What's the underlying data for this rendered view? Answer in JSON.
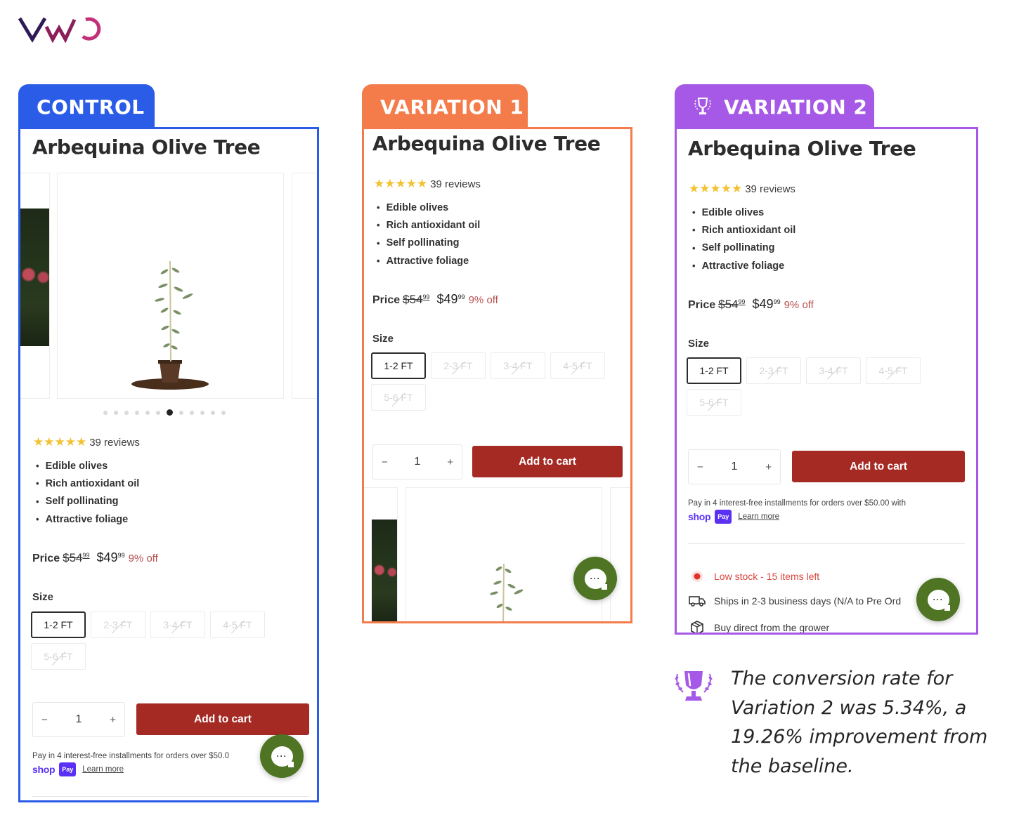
{
  "brand": {
    "logo_text": "VWO",
    "colors": {
      "v": "#2e1a55",
      "w": "#8a1f5a",
      "o": "#c2307a"
    }
  },
  "colors": {
    "control": "#2a5ce8",
    "variation1": "#f47c4a",
    "variation2": "#a659e6",
    "cart_button": "#a62a24",
    "chat_button": "#4e7424",
    "star": "#f2c232",
    "discount": "#b85050",
    "low_stock": "#d9453d"
  },
  "panels": [
    {
      "id": "control",
      "tab_label": "CONTROL",
      "has_trophy": false,
      "product_title": "Arbequina Olive Tree",
      "rating": {
        "stars": 5,
        "max": 5,
        "reviews_label": "39 reviews"
      },
      "bullets": [
        "Edible olives",
        "Rich antioxidant oil",
        "Self pollinating",
        "Attractive foliage"
      ],
      "price": {
        "label": "Price",
        "old_whole": "$54",
        "old_cents": "99",
        "new_whole": "$49",
        "new_cents": "99",
        "discount": "9% off"
      },
      "size": {
        "label": "Size",
        "options": [
          {
            "label": "1-2 FT",
            "state": "selected"
          },
          {
            "label": "2-3 FT",
            "state": "disabled"
          },
          {
            "label": "3-4 FT",
            "state": "disabled"
          },
          {
            "label": "4-5 FT",
            "state": "disabled"
          },
          {
            "label": "5-6 FT",
            "state": "disabled"
          }
        ]
      },
      "quantity": {
        "minus": "−",
        "value": "1",
        "plus": "+"
      },
      "add_to_cart": "Add to cart",
      "gallery": {
        "dot_count": 12,
        "active_index": 6
      },
      "installments": {
        "text": "Pay in 4 interest-free installments for orders over $50.0",
        "shop": "shop",
        "pay": "Pay",
        "learn_more": "Learn more"
      }
    },
    {
      "id": "variation1",
      "tab_label": "VARIATION 1",
      "has_trophy": false,
      "product_title": "Arbequina Olive Tree",
      "rating": {
        "stars": 5,
        "max": 5,
        "reviews_label": "39 reviews"
      },
      "bullets": [
        "Edible olives",
        "Rich antioxidant oil",
        "Self pollinating",
        "Attractive foliage"
      ],
      "price": {
        "label": "Price",
        "old_whole": "$54",
        "old_cents": "99",
        "new_whole": "$49",
        "new_cents": "99",
        "discount": "9% off"
      },
      "size": {
        "label": "Size",
        "options": [
          {
            "label": "1-2 FT",
            "state": "selected"
          },
          {
            "label": "2-3 FT",
            "state": "disabled"
          },
          {
            "label": "3-4 FT",
            "state": "disabled"
          },
          {
            "label": "4-5 FT",
            "state": "disabled"
          },
          {
            "label": "5-6 FT",
            "state": "disabled"
          }
        ]
      },
      "quantity": {
        "minus": "−",
        "value": "1",
        "plus": "+"
      },
      "add_to_cart": "Add to cart"
    },
    {
      "id": "variation2",
      "tab_label": "VARIATION 2",
      "has_trophy": true,
      "product_title": "Arbequina Olive Tree",
      "rating": {
        "stars": 5,
        "max": 5,
        "reviews_label": "39 reviews"
      },
      "bullets": [
        "Edible olives",
        "Rich antioxidant oil",
        "Self pollinating",
        "Attractive foliage"
      ],
      "price": {
        "label": "Price",
        "old_whole": "$54",
        "old_cents": "99",
        "new_whole": "$49",
        "new_cents": "99",
        "discount": "9% off"
      },
      "size": {
        "label": "Size",
        "options": [
          {
            "label": "1-2 FT",
            "state": "selected"
          },
          {
            "label": "2-3 FT",
            "state": "disabled"
          },
          {
            "label": "3-4 FT",
            "state": "disabled"
          },
          {
            "label": "4-5 FT",
            "state": "disabled"
          },
          {
            "label": "5-6 FT",
            "state": "disabled"
          }
        ]
      },
      "quantity": {
        "minus": "−",
        "value": "1",
        "plus": "+"
      },
      "add_to_cart": "Add to cart",
      "installments": {
        "text": "Pay in 4 interest-free installments for orders over $50.00 with",
        "shop": "shop",
        "pay": "Pay",
        "learn_more": "Learn more"
      },
      "info_rows": [
        {
          "icon": "low-stock-dot-icon",
          "text": "Low stock - 15 items left"
        },
        {
          "icon": "truck-icon",
          "text": "Ships in 2-3 business days (N/A to Pre Ord"
        },
        {
          "icon": "box-icon",
          "text": "Buy direct from the grower"
        }
      ]
    }
  ],
  "result": {
    "text": "The conversion rate for Variation 2 was 5.34%, a 19.26% improvement from the baseline.",
    "conversion_rate": "5.34%",
    "improvement": "19.26%"
  }
}
